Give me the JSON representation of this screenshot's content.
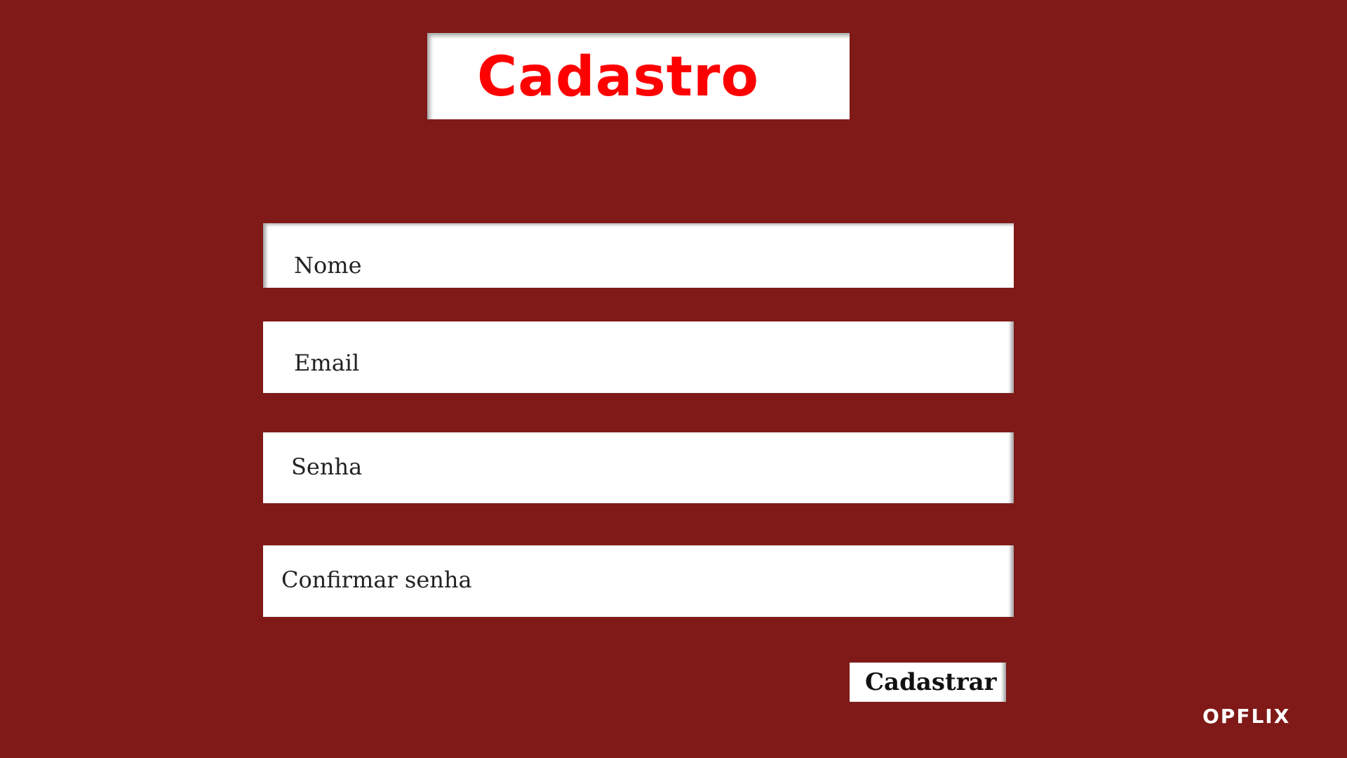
{
  "page": {
    "title": "Cadastro",
    "brand": "OPFLIX"
  },
  "form": {
    "fields": [
      {
        "placeholder": "Nome"
      },
      {
        "placeholder": "Email"
      },
      {
        "placeholder": "Senha"
      },
      {
        "placeholder": "Confirmar senha"
      }
    ],
    "submit_label": "Cadastrar"
  },
  "colors": {
    "background": "#7f1a18",
    "title_text": "#ff0000",
    "field_background": "#ffffff",
    "brand_text": "#ffffff"
  }
}
